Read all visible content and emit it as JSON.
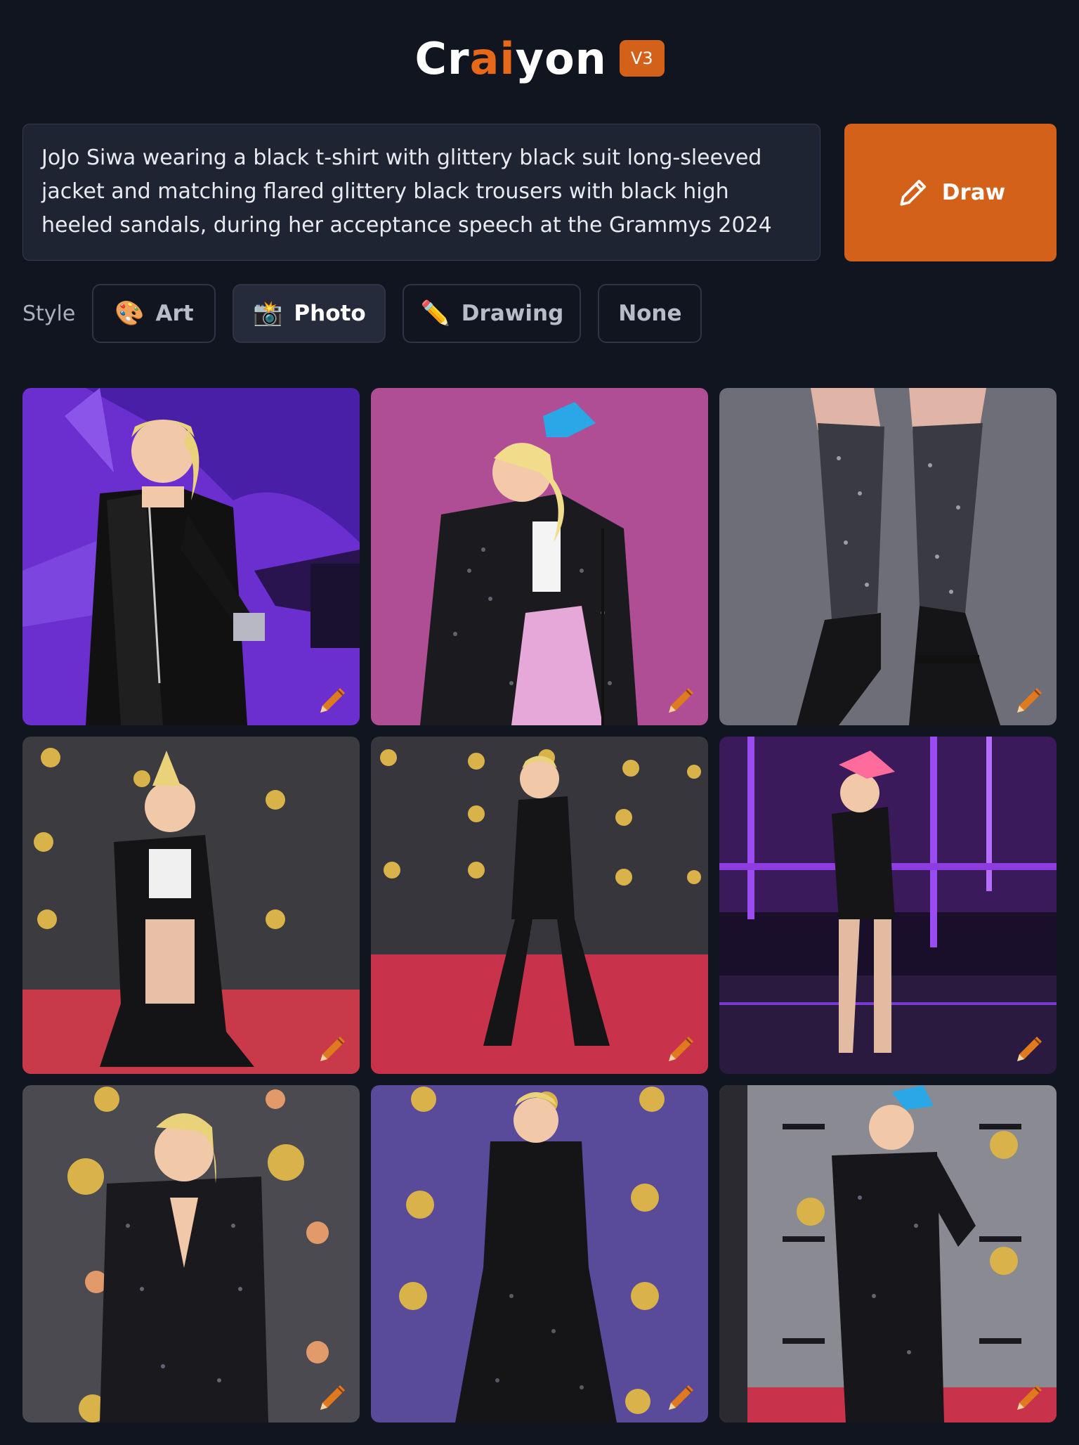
{
  "header": {
    "logo_pre": "Cr",
    "logo_ai": "ai",
    "logo_post": "yon",
    "version_badge": "V3"
  },
  "prompt": {
    "text": "JoJo Siwa wearing a black t-shirt with glittery black suit long-sleeved jacket and matching flared glittery black trousers with black high heeled sandals, during her acceptance speech at the Grammys 2024"
  },
  "draw_button": {
    "label": "Draw",
    "icon": "pencil-icon"
  },
  "style": {
    "label": "Style",
    "options": [
      {
        "label": "Art",
        "icon": "🎨",
        "active": false
      },
      {
        "label": "Photo",
        "icon": "📸",
        "active": true
      },
      {
        "label": "Drawing",
        "icon": "✏️",
        "active": false
      },
      {
        "label": "None",
        "icon": "",
        "active": false
      }
    ]
  },
  "results": [
    {
      "scene": "stage-purple"
    },
    {
      "scene": "pink-backdrop"
    },
    {
      "scene": "legs-closeup"
    },
    {
      "scene": "red-carpet"
    },
    {
      "scene": "red-carpet-wide"
    },
    {
      "scene": "stage-lights"
    },
    {
      "scene": "grammy-wall"
    },
    {
      "scene": "purple-wall"
    },
    {
      "scene": "grey-wall"
    }
  ],
  "colors": {
    "accent": "#d4611a",
    "background": "#111520",
    "panel": "#1f2433"
  }
}
